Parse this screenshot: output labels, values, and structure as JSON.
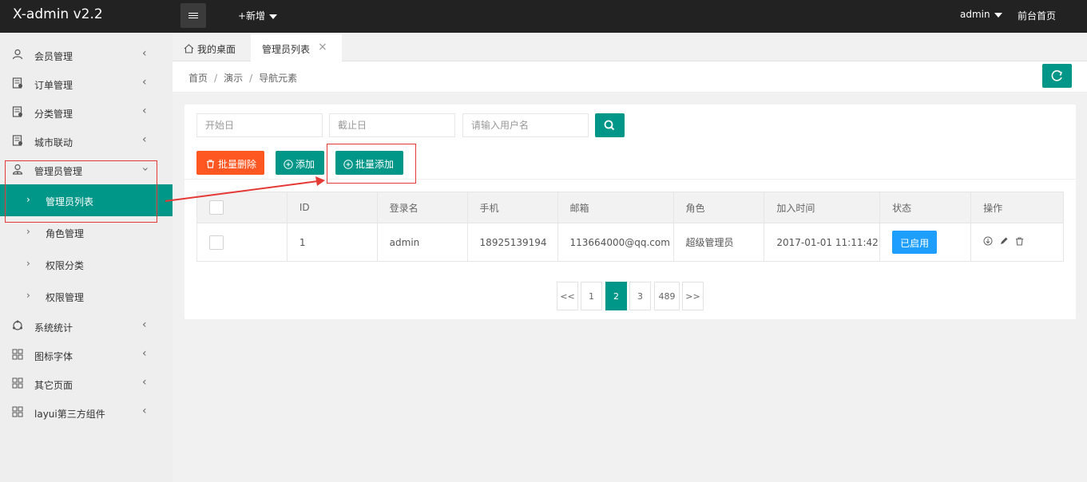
{
  "app": {
    "title": "X-admin v2.2"
  },
  "topnav": {
    "add_label": "+新增",
    "user_label": "admin",
    "front_label": "前台首页"
  },
  "sidebar": {
    "items": [
      {
        "label": "会员管理",
        "icon": "user-icon"
      },
      {
        "label": "订单管理",
        "icon": "order-icon"
      },
      {
        "label": "分类管理",
        "icon": "category-icon"
      },
      {
        "label": "城市联动",
        "icon": "city-icon"
      },
      {
        "label": "管理员管理",
        "icon": "admin-icon"
      },
      {
        "label": "系统统计",
        "icon": "stats-icon"
      },
      {
        "label": "图标字体",
        "icon": "grid-icon"
      },
      {
        "label": "其它页面",
        "icon": "grid-icon"
      },
      {
        "label": "layui第三方组件",
        "icon": "grid-icon"
      }
    ],
    "subitems": [
      {
        "label": "管理员列表"
      },
      {
        "label": "角色管理"
      },
      {
        "label": "权限分类"
      },
      {
        "label": "权限管理"
      }
    ]
  },
  "tabs": {
    "home": "我的桌面",
    "active": "管理员列表"
  },
  "breadcrumb": {
    "home": "首页",
    "level2": "演示",
    "level3": "导航元素"
  },
  "filters": {
    "start_placeholder": "开始日",
    "end_placeholder": "截止日",
    "user_placeholder": "请输入用户名"
  },
  "actions": {
    "batch_delete": "批量删除",
    "add": "添加",
    "batch_add": "批量添加"
  },
  "table": {
    "headers": [
      "ID",
      "登录名",
      "手机",
      "邮箱",
      "角色",
      "加入时间",
      "状态",
      "操作"
    ],
    "rows": [
      {
        "id": "1",
        "login": "admin",
        "phone": "18925139194",
        "email": "113664000@qq.com",
        "role": "超级管理员",
        "joined": "2017-01-01 11:11:42",
        "status": "已启用"
      }
    ]
  },
  "pagination": {
    "prev": "<<",
    "pages": [
      "1",
      "2",
      "3",
      "489"
    ],
    "next": ">>",
    "current": "2"
  },
  "colors": {
    "primary": "#009688",
    "danger": "#ff5722",
    "info": "#1e9fff",
    "topbar": "#222222",
    "annotation": "#e53935"
  }
}
